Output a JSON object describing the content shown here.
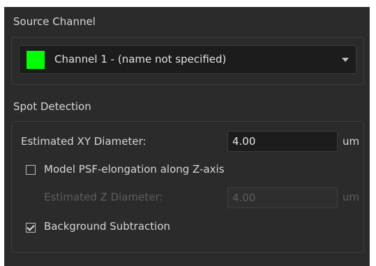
{
  "source_channel": {
    "title": "Source Channel",
    "selected_label": "Channel 1 - (name not specified)",
    "swatch_color": "#00ff00"
  },
  "spot_detection": {
    "title": "Spot Detection",
    "xy_diameter": {
      "label": "Estimated XY Diameter:",
      "value": "4.00",
      "unit": "um"
    },
    "psf_elongation": {
      "label": "Model PSF-elongation along Z-axis",
      "checked": false
    },
    "z_diameter": {
      "label": "Estimated Z Diameter:",
      "value": "4.00",
      "unit": "um",
      "enabled": false
    },
    "background_subtraction": {
      "label": "Background Subtraction",
      "checked": true
    }
  },
  "colors": {
    "panel_bg": "#2b2b2b",
    "input_bg": "#1c1c1c",
    "text": "#d6d6d6",
    "disabled_text": "#5e5e5e"
  }
}
